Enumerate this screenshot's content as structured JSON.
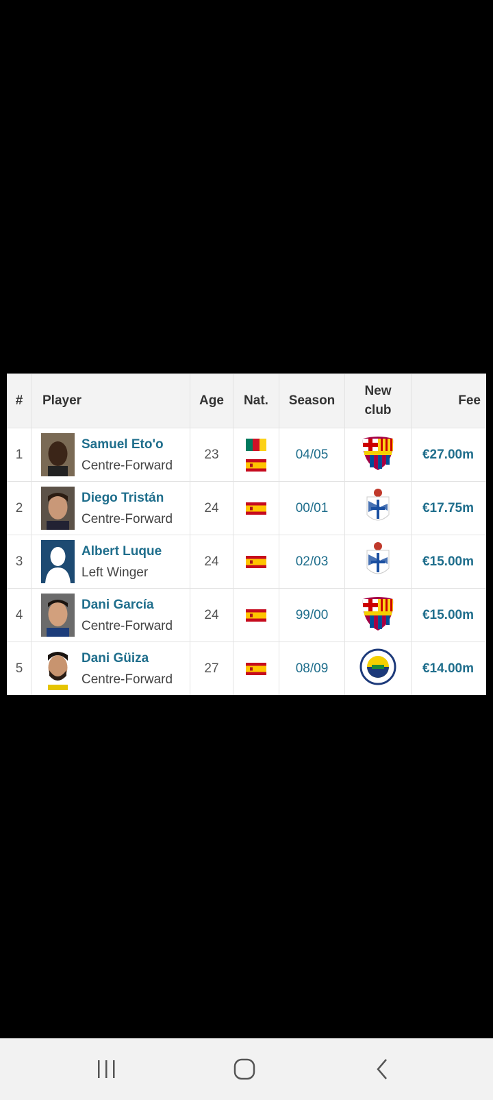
{
  "table": {
    "headers": {
      "rank": "#",
      "player": "Player",
      "age": "Age",
      "nat": "Nat.",
      "season": "Season",
      "new_club_line1": "New",
      "new_club_line2": "club",
      "fee": "Fee"
    },
    "rows": [
      {
        "rank": "1",
        "name": "Samuel Eto'o",
        "position": "Centre-Forward",
        "age": "23",
        "nationalities": [
          "cameroon-flag",
          "spain-flag"
        ],
        "season": "04/05",
        "club_crest": "fc-barcelona-crest",
        "fee": "€27.00m"
      },
      {
        "rank": "2",
        "name": "Diego Tristán",
        "position": "Centre-Forward",
        "age": "24",
        "nationalities": [
          "spain-flag"
        ],
        "season": "00/01",
        "club_crest": "deportivo-la-coruna-crest",
        "fee": "€17.75m"
      },
      {
        "rank": "3",
        "name": "Albert Luque",
        "position": "Left Winger",
        "age": "24",
        "nationalities": [
          "spain-flag"
        ],
        "season": "02/03",
        "club_crest": "deportivo-la-coruna-crest",
        "fee": "€15.00m"
      },
      {
        "rank": "4",
        "name": "Dani García",
        "position": "Centre-Forward",
        "age": "24",
        "nationalities": [
          "spain-flag"
        ],
        "season": "99/00",
        "club_crest": "fc-barcelona-crest",
        "fee": "€15.00m"
      },
      {
        "rank": "5",
        "name": "Dani Güiza",
        "position": "Centre-Forward",
        "age": "27",
        "nationalities": [
          "spain-flag"
        ],
        "season": "08/09",
        "club_crest": "fenerbahce-crest",
        "fee": "€14.00m"
      }
    ]
  },
  "navbar": {
    "icons": [
      "recent-apps-icon",
      "home-icon",
      "back-icon"
    ]
  },
  "colors": {
    "link": "#1f6e8c",
    "header_bg": "#f3f3f3",
    "navbar_bg": "#f2f2f2"
  }
}
